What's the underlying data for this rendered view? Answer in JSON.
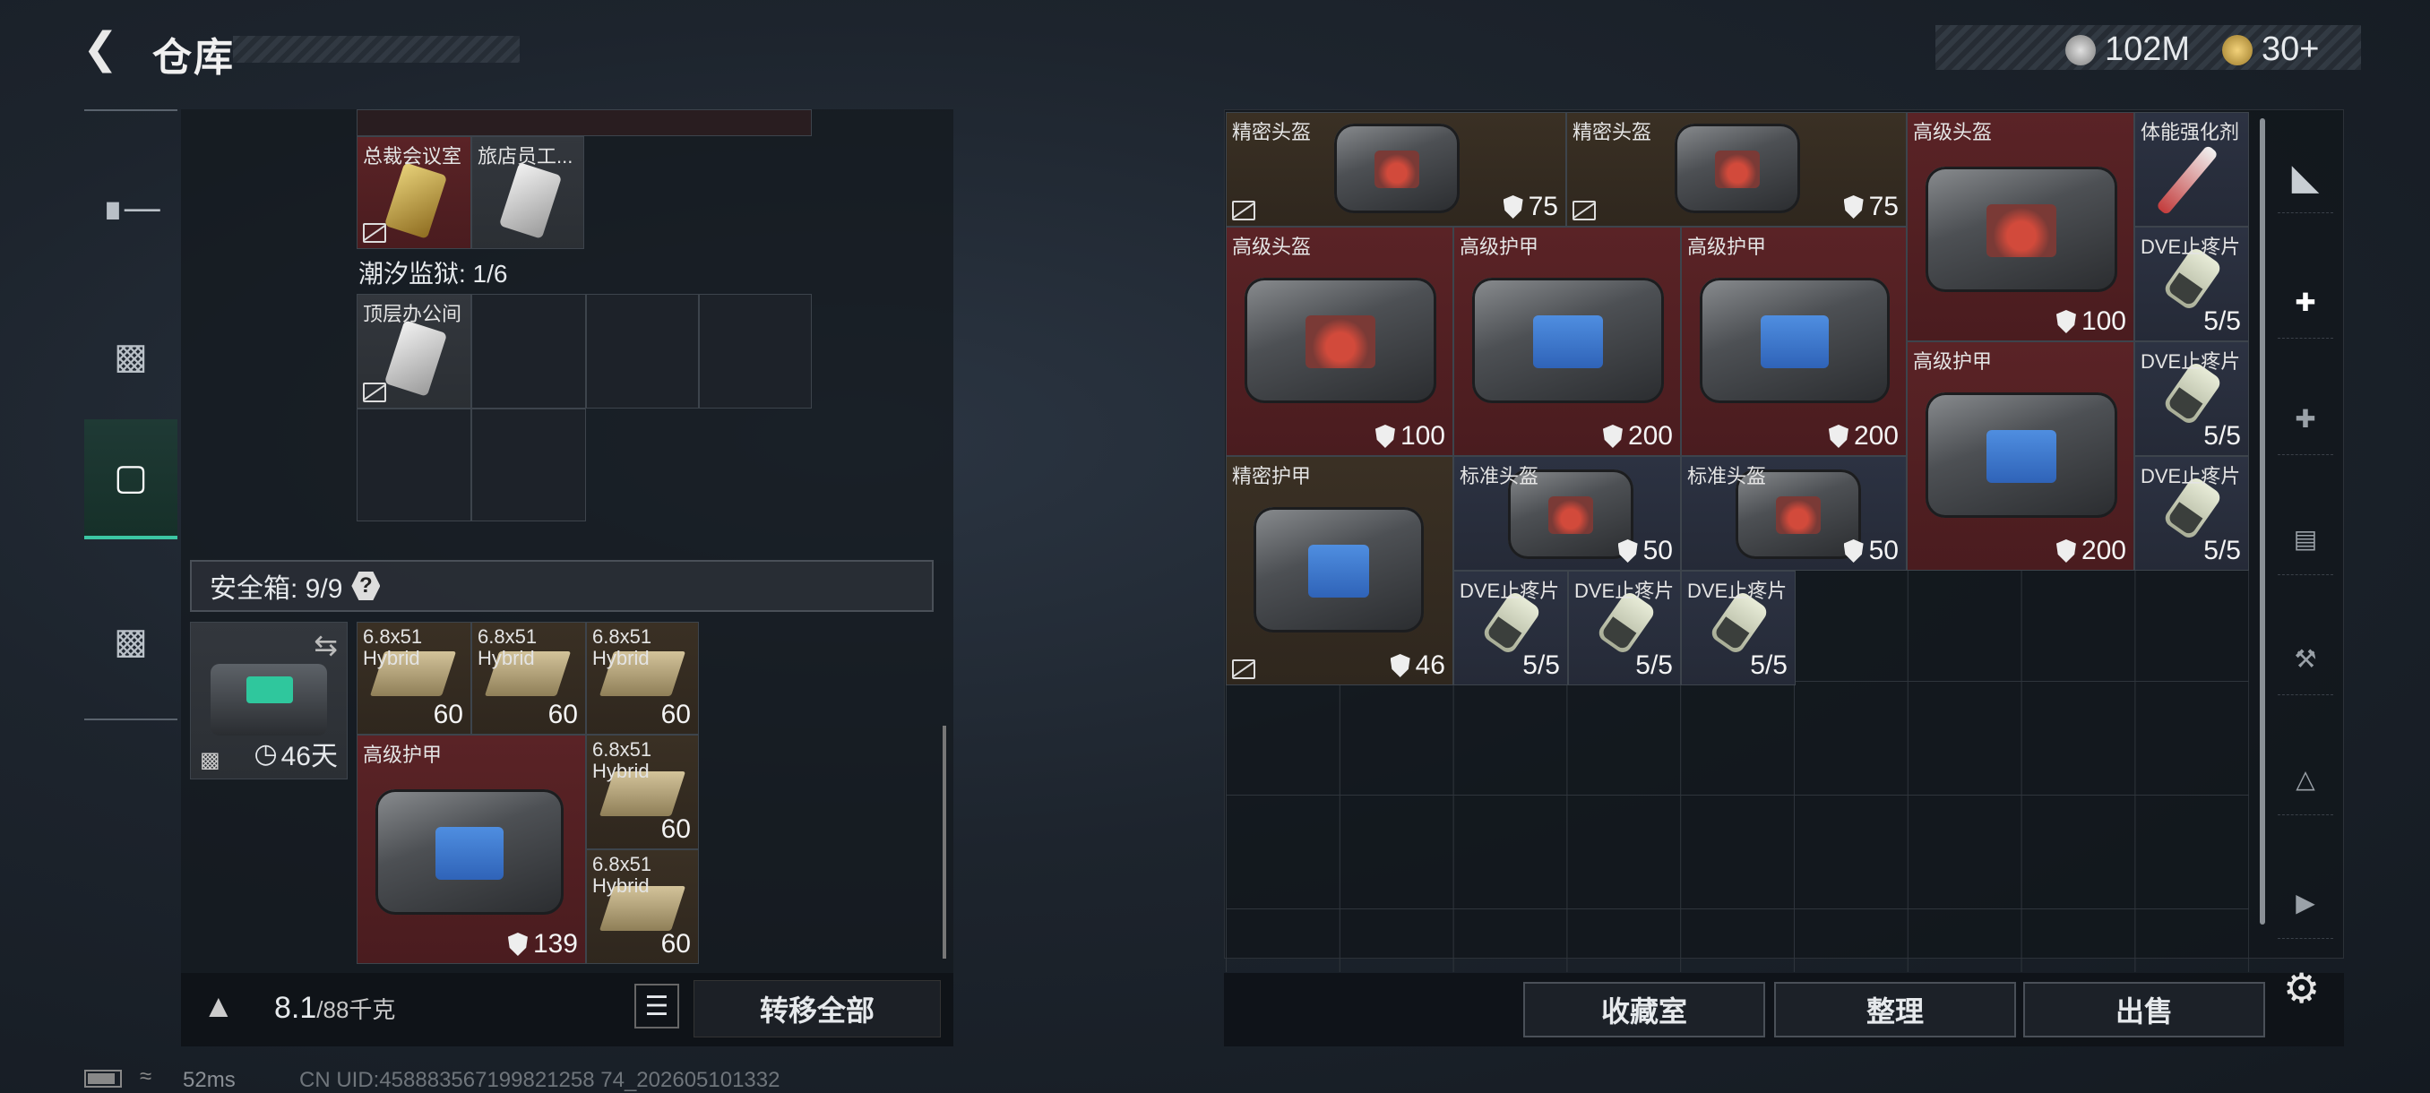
{
  "header": {
    "back_icon": "chevron-left-icon",
    "title": "仓库"
  },
  "currency": [
    {
      "icon": "silver-coin-icon",
      "value": "102M"
    },
    {
      "icon": "gold-coin-icon",
      "value": "30+"
    }
  ],
  "left_sidebar": {
    "items": [
      {
        "name": "weapon",
        "icon": "gun-icon"
      },
      {
        "name": "armor",
        "icon": "vest-icon"
      },
      {
        "name": "backpack",
        "icon": "backpack-icon",
        "active": true
      },
      {
        "name": "case",
        "icon": "briefcase-icon"
      }
    ]
  },
  "left_panel": {
    "keycards_top": [
      {
        "name": "总裁会议室",
        "color": "#c9a74a"
      },
      {
        "name": "旅店员工...",
        "color": "#d6d6d6"
      }
    ],
    "prison_label": "潮汐监狱: 1/6",
    "keycard_prison": {
      "name": "顶层办公间"
    },
    "safe_box": {
      "label": "安全箱: 9/9",
      "help": "?",
      "timer": "46天"
    },
    "safe_items": [
      {
        "name": "6.8x51 Hybrid",
        "qty": "60"
      },
      {
        "name": "6.8x51 Hybrid",
        "qty": "60"
      },
      {
        "name": "6.8x51 Hybrid",
        "qty": "60"
      },
      {
        "name": "高级护甲",
        "durability": "139"
      },
      {
        "name": "6.8x51 Hybrid",
        "qty": "60"
      },
      {
        "name": "6.8x51 Hybrid",
        "qty": "60"
      }
    ],
    "weight": {
      "current": "8.1",
      "max": "/88千克"
    },
    "transfer_label": "转移全部"
  },
  "right_panel": {
    "items": [
      {
        "name": "精密头盔",
        "durability": "75"
      },
      {
        "name": "精密头盔",
        "durability": "75"
      },
      {
        "name": "高级头盔",
        "durability": "100"
      },
      {
        "name": "体能强化剂"
      },
      {
        "name": "高级头盔",
        "durability": "100"
      },
      {
        "name": "高级护甲",
        "durability": "200"
      },
      {
        "name": "高级护甲",
        "durability": "200"
      },
      {
        "name": "DVE止疼片",
        "qty": "5/5"
      },
      {
        "name": "高级护甲",
        "durability": "200"
      },
      {
        "name": "DVE止疼片",
        "qty": "5/5"
      },
      {
        "name": "精密护甲",
        "durability": "46"
      },
      {
        "name": "标准头盔",
        "durability": "50"
      },
      {
        "name": "标准头盔",
        "durability": "50"
      },
      {
        "name": "DVE止疼片",
        "qty": "5/5"
      },
      {
        "name": "DVE止疼片",
        "qty": "5/5"
      },
      {
        "name": "DVE止疼片",
        "qty": "5/5"
      },
      {
        "name": "DVE止疼片",
        "qty": "5/5"
      }
    ],
    "buttons": {
      "collection": "收藏室",
      "sort": "整理",
      "sell": "出售"
    }
  },
  "right_sidebar": {
    "icons": [
      "helmet-slot-icon",
      "medkit-iv-icon",
      "medkit-iv-2-icon",
      "folder-iv-icon",
      "tool-iv-icon",
      "triangle-iv-icon",
      "gti-icon"
    ]
  },
  "footer": {
    "ping": "52ms",
    "uid": "CN UID:458883567199821258 74_202605101332"
  }
}
